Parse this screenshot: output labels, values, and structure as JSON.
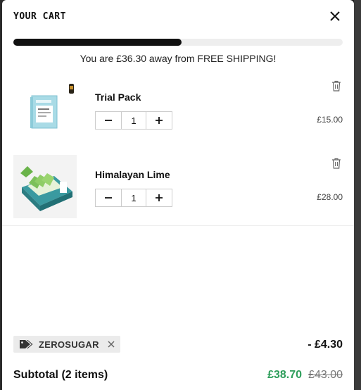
{
  "cart": {
    "title": "YOUR CART",
    "close_icon": "close-icon"
  },
  "shipping": {
    "message": "You are £36.30 away from FREE SHIPPING!",
    "progress_fraction": 0.51
  },
  "items": [
    {
      "name": "Trial Pack",
      "quantity": "1",
      "price": "£15.00",
      "image": "trial-pack-box-image"
    },
    {
      "name": "Himalayan Lime",
      "quantity": "1",
      "price": "£28.00",
      "image": "himalayan-lime-box-image"
    }
  ],
  "icons": {
    "decrement": "minus-icon",
    "increment": "plus-icon",
    "remove": "trash-icon",
    "tag": "tag-icon",
    "remove_coupon": "close-icon"
  },
  "coupon": {
    "code": "ZEROSUGAR",
    "discount": "- £4.30"
  },
  "subtotal": {
    "label": "Subtotal (2 items)",
    "discounted": "£38.70",
    "original": "£43.00"
  },
  "colors": {
    "accent_green": "#2e9e5b",
    "progress_fill": "#111111",
    "progress_track": "#eeeeee"
  }
}
